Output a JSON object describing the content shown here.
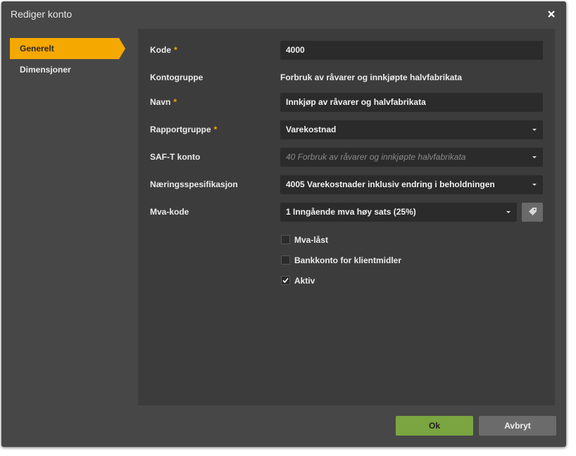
{
  "dialog": {
    "title": "Rediger konto"
  },
  "sidebar": {
    "items": [
      {
        "label": "Generelt"
      },
      {
        "label": "Dimensjoner"
      }
    ]
  },
  "form": {
    "required_mark": "*",
    "kode": {
      "label": "Kode",
      "value": "4000"
    },
    "kontogruppe": {
      "label": "Kontogruppe",
      "value": "Forbruk av råvarer og innkjøpte halvfabrikata"
    },
    "navn": {
      "label": "Navn",
      "value": "Innkjøp av råvarer og halvfabrikata"
    },
    "rapportgruppe": {
      "label": "Rapportgruppe",
      "value": "Varekostnad"
    },
    "saft": {
      "label": "SAF-T konto",
      "placeholder": "40 Forbruk av råvarer og innkjøpte halvfabrikata"
    },
    "naering": {
      "label": "Næringsspesifikasjon",
      "value": "4005 Varekostnader inklusiv endring i beholdningen"
    },
    "mva": {
      "label": "Mva-kode",
      "value": "1 Inngående mva høy sats (25%)"
    },
    "checkboxes": [
      {
        "label": "Mva-låst",
        "checked": false
      },
      {
        "label": "Bankkonto for klientmidler",
        "checked": false
      },
      {
        "label": "Aktiv",
        "checked": true
      }
    ]
  },
  "footer": {
    "ok_label": "Ok",
    "cancel_label": "Avbryt"
  },
  "colors": {
    "accent": "#f5a800",
    "ok": "#7aa540",
    "background": "#474747",
    "panel": "#3c3c3c"
  }
}
